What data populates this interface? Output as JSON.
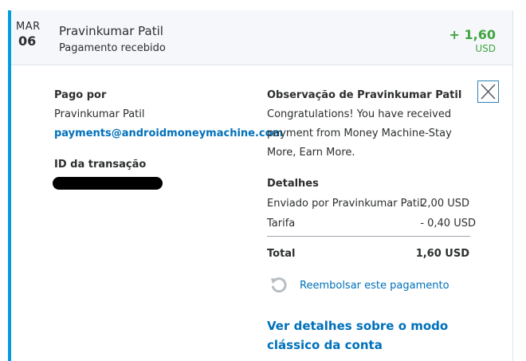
{
  "transaction": {
    "date_month": "MAR",
    "date_day": "06",
    "name": "Pravinkumar Patil",
    "subtitle": "Pagamento recebido",
    "amount": "+ 1,60",
    "currency": "USD"
  },
  "paid_by": {
    "label": "Pago por",
    "name": "Pravinkumar Patil",
    "email": "payments@androidmoneymachine.com"
  },
  "transaction_id": {
    "label": "ID da transação"
  },
  "note": {
    "label": "Observação de Pravinkumar Patil",
    "lines": [
      "Congratulations! You have received",
      "payment from Money Machine-Stay",
      "More, Earn More."
    ]
  },
  "details": {
    "label": "Detalhes",
    "rows": [
      {
        "label": "Enviado por Pravinkumar Patil",
        "value": "2,00 USD"
      },
      {
        "label": "Tarifa",
        "value": "- 0,40 USD"
      }
    ],
    "total_label": "Total",
    "total_value": "1,60 USD"
  },
  "actions": {
    "refund_label": "Reembolsar este pagamento",
    "classic_view_line1": "Ver detalhes sobre o modo",
    "classic_view_line2": "clássico da conta"
  },
  "icons": {
    "close": "close-icon",
    "refund": "refresh-icon"
  },
  "colors": {
    "accent": "#009cde",
    "positive": "#41a541",
    "link": "#0070ba"
  }
}
